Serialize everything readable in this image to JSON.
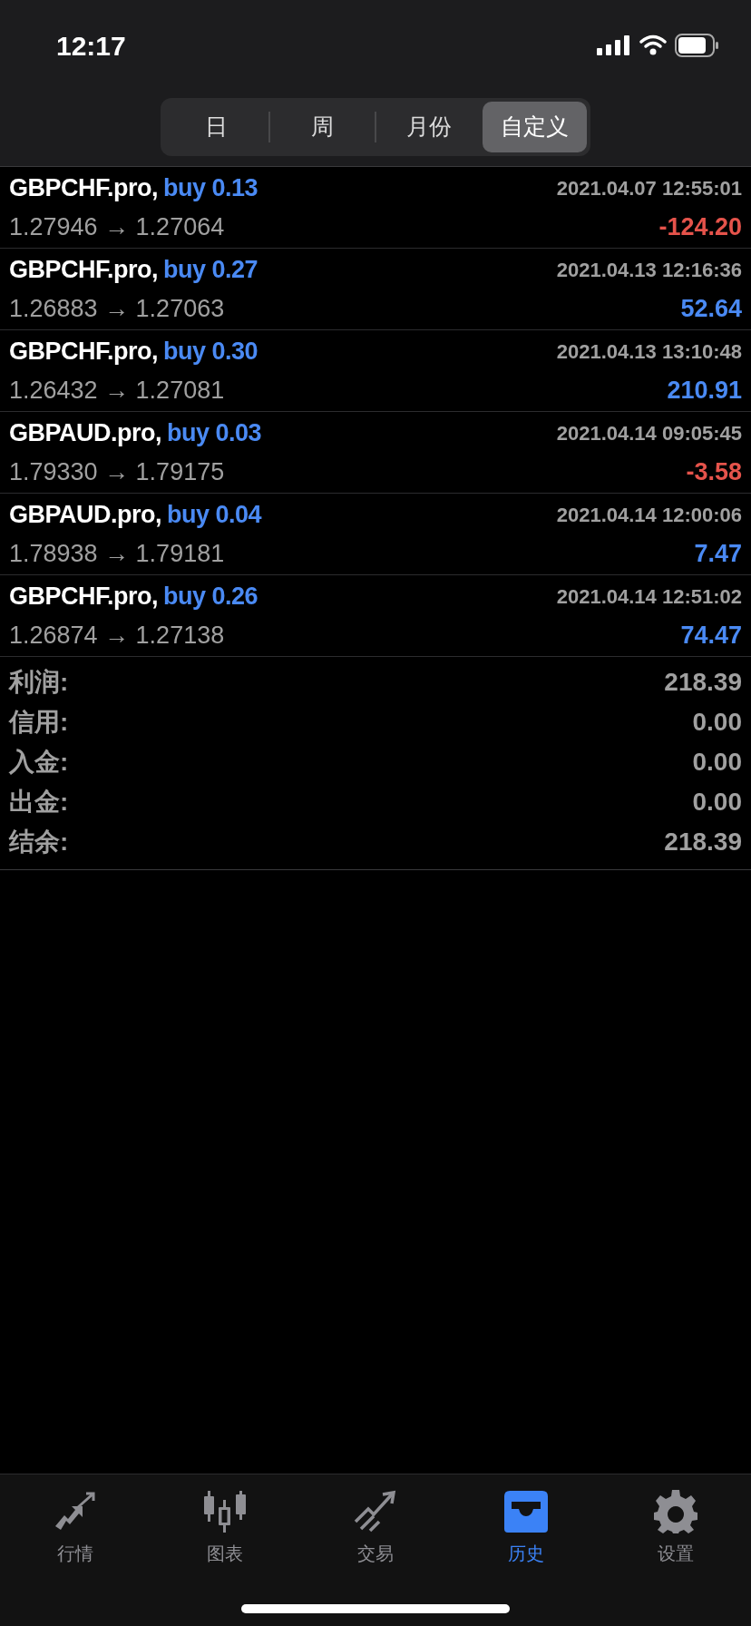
{
  "status_bar": {
    "time": "12:17"
  },
  "periods": [
    {
      "label": "日",
      "selected": false
    },
    {
      "label": "周",
      "selected": false
    },
    {
      "label": "月份",
      "selected": false
    },
    {
      "label": "自定义",
      "selected": true
    }
  ],
  "deals": [
    {
      "symbol": "GBPCHF.pro,",
      "side": "buy 0.13",
      "time": "2021.04.07 12:55:01",
      "prices": "1.27946 → 1.27064",
      "profit": "-124.20",
      "loss": true
    },
    {
      "symbol": "GBPCHF.pro,",
      "side": "buy 0.27",
      "time": "2021.04.13 12:16:36",
      "prices": "1.26883 → 1.27063",
      "profit": "52.64",
      "loss": false
    },
    {
      "symbol": "GBPCHF.pro,",
      "side": "buy 0.30",
      "time": "2021.04.13 13:10:48",
      "prices": "1.26432 → 1.27081",
      "profit": "210.91",
      "loss": false
    },
    {
      "symbol": "GBPAUD.pro,",
      "side": "buy 0.03",
      "time": "2021.04.14 09:05:45",
      "prices": "1.79330 → 1.79175",
      "profit": "-3.58",
      "loss": true
    },
    {
      "symbol": "GBPAUD.pro,",
      "side": "buy 0.04",
      "time": "2021.04.14 12:00:06",
      "prices": "1.78938 → 1.79181",
      "profit": "7.47",
      "loss": false
    },
    {
      "symbol": "GBPCHF.pro,",
      "side": "buy 0.26",
      "time": "2021.04.14 12:51:02",
      "prices": "1.26874 → 1.27138",
      "profit": "74.47",
      "loss": false
    }
  ],
  "summary": [
    {
      "label": "利润:",
      "value": "218.39"
    },
    {
      "label": "信用:",
      "value": "0.00"
    },
    {
      "label": "入金:",
      "value": "0.00"
    },
    {
      "label": "出金:",
      "value": "0.00"
    },
    {
      "label": "结余:",
      "value": "218.39"
    }
  ],
  "tab_bar": [
    {
      "kind": "quotes",
      "label": "行情",
      "selected": false
    },
    {
      "kind": "chart",
      "label": "图表",
      "selected": false
    },
    {
      "kind": "trade",
      "label": "交易",
      "selected": false
    },
    {
      "kind": "history",
      "label": "历史",
      "selected": true
    },
    {
      "kind": "settings",
      "label": "设置",
      "selected": false
    }
  ]
}
